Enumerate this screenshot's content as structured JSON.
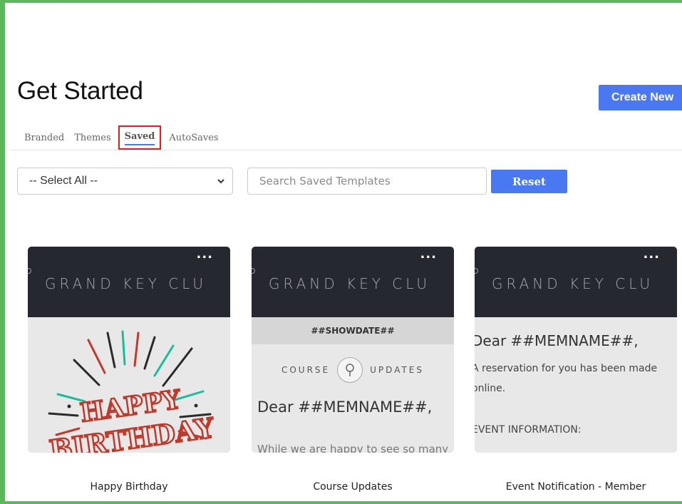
{
  "header": {
    "title": "Get Started",
    "create_button": "Create New"
  },
  "tabs": [
    {
      "label": "Branded",
      "active": false
    },
    {
      "label": "Themes",
      "active": false
    },
    {
      "label": "Saved",
      "active": true
    },
    {
      "label": "AutoSaves",
      "active": false
    }
  ],
  "filters": {
    "select_value": "-- Select All --",
    "search_placeholder": "Search Saved Templates",
    "search_value": "",
    "reset_label": "Reset"
  },
  "cards": [
    {
      "name": "Happy Birthday",
      "brand": "GRAND KEY CLU",
      "menu": "...",
      "preview": {
        "art_top": "HAPPY",
        "art_bottom": "BIRTHDAY"
      }
    },
    {
      "name": "Course Updates",
      "brand": "GRAND KEY CLU",
      "menu": "...",
      "preview": {
        "showdate": "##SHOWDATE##",
        "left_word": "COURSE",
        "right_word": "UPDATES",
        "greeting": "Dear ##MEMNAME##,",
        "body": "While we are happy to see so many"
      }
    },
    {
      "name": "Event Notification - Member",
      "brand": "GRAND KEY CLU",
      "menu": "...",
      "preview": {
        "greeting": "Dear ##MEMNAME##,",
        "line1": "A reservation for you has been made",
        "line2": "online.",
        "line3": "EVENT INFORMATION:"
      }
    }
  ],
  "colors": {
    "accent": "#4a78f2",
    "frame": "#5cb85c",
    "highlight": "#e02020",
    "card_header": "#25282f"
  }
}
